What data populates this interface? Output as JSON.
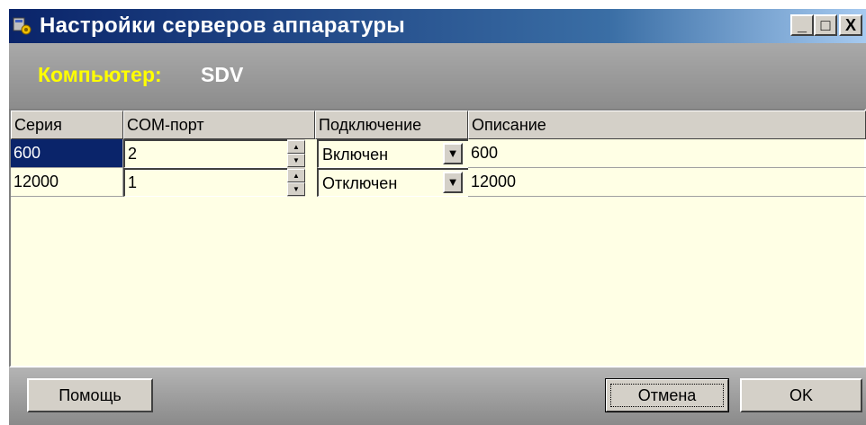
{
  "window": {
    "title": "Настройки серверов аппаратуры",
    "icon": "app-icon"
  },
  "titlebar_buttons": {
    "minimize": "_",
    "maximize": "□",
    "close": "X"
  },
  "computer": {
    "label": "Компьютер:",
    "value": "SDV"
  },
  "table": {
    "columns": [
      "Серия",
      "COM-порт",
      "Подключение",
      "Описание"
    ],
    "rows": [
      {
        "series": "600",
        "port": "2",
        "connection": "Включен",
        "description": "600",
        "selected": true
      },
      {
        "series": "12000",
        "port": "1",
        "connection": "Отключен",
        "description": "12000",
        "selected": false
      }
    ]
  },
  "buttons": {
    "help": "Помощь",
    "cancel": "Отмена",
    "ok": "OK"
  },
  "colors": {
    "title_start": "#0a246a",
    "title_end": "#a6caf0",
    "grid_bg": "#ffffe5",
    "label_yellow": "#ffff00",
    "selection": "#0a246a"
  }
}
